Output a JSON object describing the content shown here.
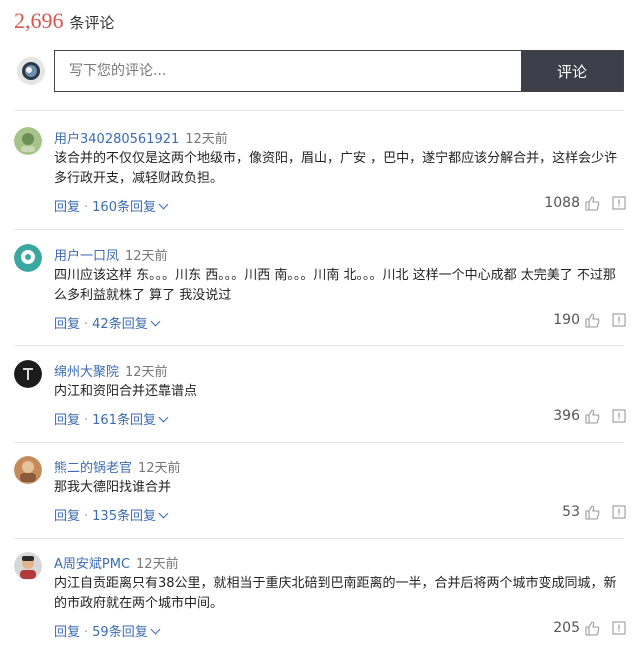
{
  "header": {
    "comment_count": "2,696",
    "count_label": "条评论"
  },
  "composer": {
    "placeholder": "写下您的评论...",
    "submit_label": "评论"
  },
  "comments": [
    {
      "user": "用户340280561921",
      "time": "12天前",
      "text": "该合并的不仅仅是这两个地级市，像资阳，眉山，广安 ，巴中，遂宁都应该分解合并，这样会少许多行政开支，减轻财政负担。",
      "reply": "回复",
      "replies": "160条回复",
      "likes": "1088"
    },
    {
      "user": "用户一口凤",
      "time": "12天前",
      "text": "四川应该这样 东。。。川东 西。。。川西 南。。。川南 北。。。川北 这样一个中心成都 太完美了 不过那么多利益就株了 算了 我没说过",
      "reply": "回复",
      "replies": "42条回复",
      "likes": "190"
    },
    {
      "user": "绵州大聚院",
      "time": "12天前",
      "text": "内江和资阳合并还靠谱点",
      "reply": "回复",
      "replies": "161条回复",
      "likes": "396"
    },
    {
      "user": "熊二的锅老官",
      "time": "12天前",
      "text": "那我大德阳找谁合并",
      "reply": "回复",
      "replies": "135条回复",
      "likes": "53"
    },
    {
      "user": "A周安斌PMC",
      "time": "12天前",
      "text": "内江自贡距离只有38公里，就相当于重庆北碚到巴南距离的一半，合并后将两个城市变成同城，新的市政府就在两个城市中间。",
      "reply": "回复",
      "replies": "59条回复",
      "likes": "205"
    }
  ],
  "icons": {
    "like": "thumbs-up-icon",
    "report": "report-icon",
    "expand": "chevron-down-icon"
  },
  "colors": {
    "count": "#d9534f",
    "link": "#3b6bb5",
    "button_bg": "#3c3f4a"
  }
}
